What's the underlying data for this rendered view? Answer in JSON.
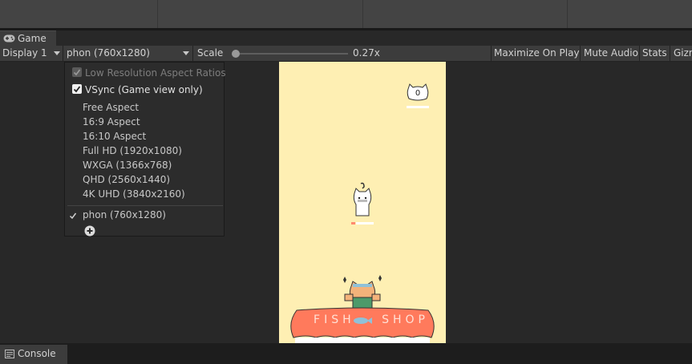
{
  "window": {
    "tab_title": "Game"
  },
  "toolbar": {
    "display": "Display 1",
    "resolution": "phon (760x1280)",
    "scale_label": "Scale",
    "scale_value": "0.27x",
    "scale_fraction": 0.03,
    "maximize": "Maximize On Play",
    "mute": "Mute Audio",
    "stats": "Stats",
    "gizmos": "Gizm"
  },
  "dropdown": {
    "low_res": "Low Resolution Aspect Ratios",
    "low_res_checked": true,
    "low_res_disabled": true,
    "vsync": "VSync (Game view only)",
    "vsync_checked": true,
    "aspects": [
      "Free Aspect",
      "16:9 Aspect",
      "16:10 Aspect",
      "Full HD (1920x1080)",
      "WXGA (1366x768)",
      "QHD (2560x1440)",
      "4K UHD (3840x2160)"
    ],
    "custom": "phon (760x1280)",
    "custom_selected": true
  },
  "game": {
    "score": "0",
    "shop_sign": "FISH SHOP",
    "background_color": "#feefb3",
    "sign_color": "#ff7a5c"
  },
  "console": {
    "tab_title": "Console"
  },
  "icons": {
    "game_tab": "gamepad-icon",
    "console_tab": "console-icon",
    "add_resolution": "plus-circle-icon",
    "checkmark": "checkmark-icon"
  }
}
